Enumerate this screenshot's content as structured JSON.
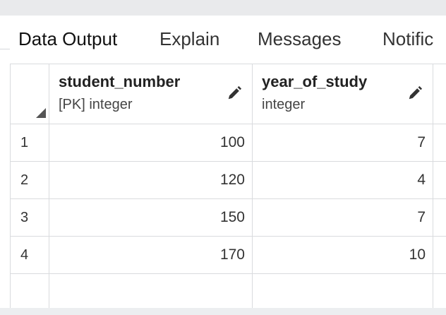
{
  "tabs": [
    {
      "label": "Data Output",
      "active": true
    },
    {
      "label": "Explain",
      "active": false
    },
    {
      "label": "Messages",
      "active": false
    },
    {
      "label": "Notific",
      "active": false
    }
  ],
  "columns": [
    {
      "name": "student_number",
      "type": "[PK] integer"
    },
    {
      "name": "year_of_study",
      "type": "integer"
    }
  ],
  "rows": [
    {
      "row": "1",
      "student_number": "100",
      "year_of_study": "7"
    },
    {
      "row": "2",
      "student_number": "120",
      "year_of_study": "4"
    },
    {
      "row": "3",
      "student_number": "150",
      "year_of_study": "7"
    },
    {
      "row": "4",
      "student_number": "170",
      "year_of_study": "10"
    }
  ],
  "icons": {
    "edit": "pencil-icon",
    "select_all": "triangle-corner-icon"
  }
}
